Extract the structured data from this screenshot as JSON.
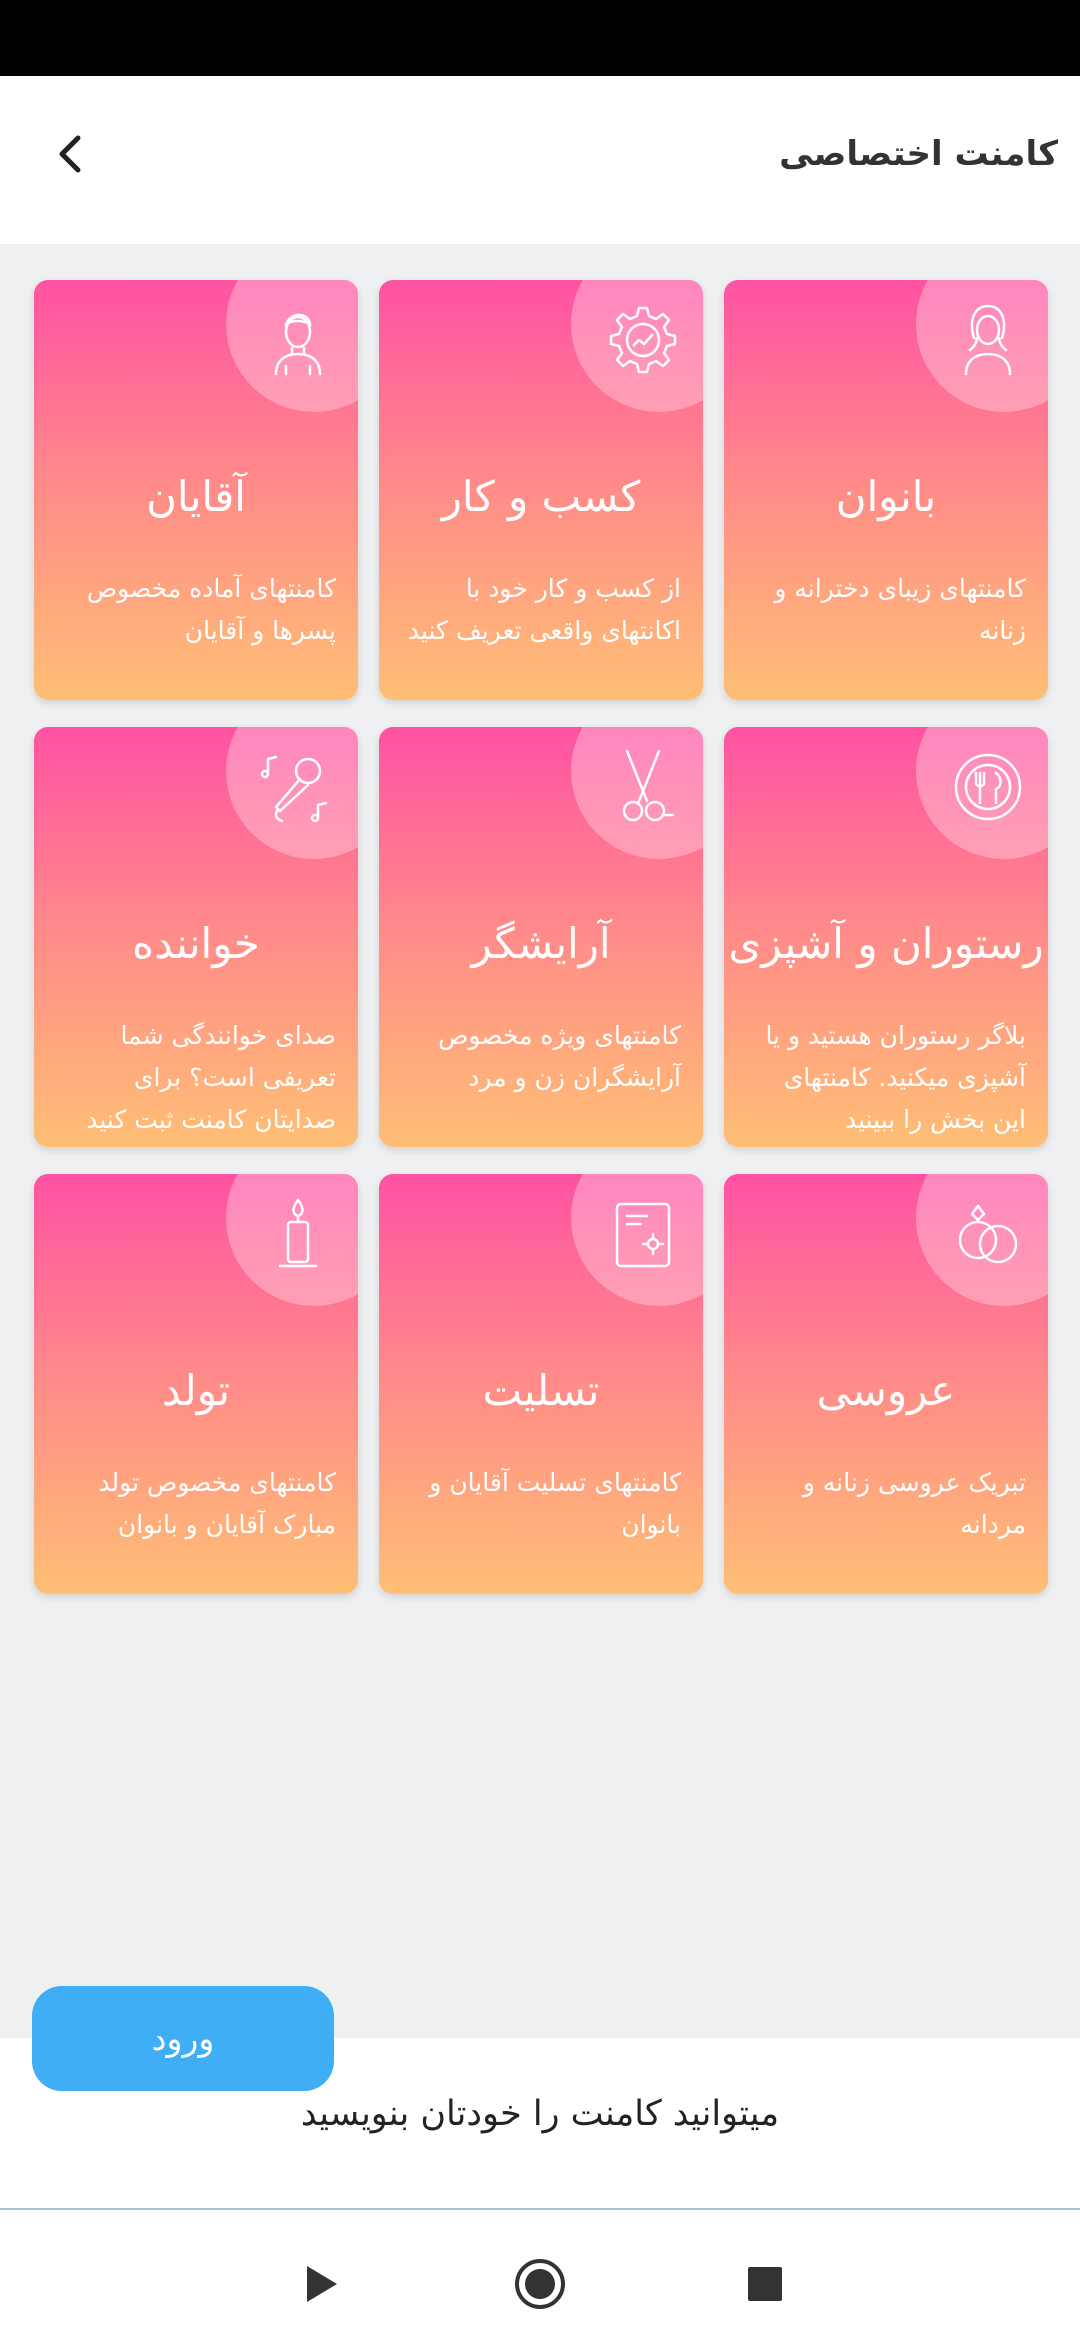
{
  "header": {
    "title": "کامنت اختصاصی"
  },
  "categories": [
    {
      "title": "بانوان",
      "description": "کامنتهای زیبای دخترانه و زنانه",
      "icon": "woman-icon"
    },
    {
      "title": "کسب و  کار",
      "description": "از کسب و کار خود با اکانتهای واقعی تعریف کنید",
      "icon": "gear-chart-icon"
    },
    {
      "title": "آقایان",
      "description": "کامنتهای آماده مخصوص پسرها و آقایان",
      "icon": "man-icon"
    },
    {
      "title": "رستوران و آشپزی",
      "description": "بلاگر رستوران هستید و یا آشپزی میکنید. کامنتهای این بخش را ببینید",
      "icon": "plate-cutlery-icon"
    },
    {
      "title": "آرایشگر",
      "description": "کامنتهای ویژه مخصوص آرایشگران زن و مرد",
      "icon": "scissors-icon"
    },
    {
      "title": "خواننده",
      "description": "صدای خوانندگی شما تعریفی است؟ برای صدایتان کامنت ثبت کنید",
      "icon": "microphone-icon"
    },
    {
      "title": "عروسی",
      "description": "تبریک عروسی زنانه و مردانه",
      "icon": "rings-icon"
    },
    {
      "title": "تسلیت",
      "description": "کامنتهای تسلیت آقایان و بانوان",
      "icon": "condolence-card-icon"
    },
    {
      "title": "تولد",
      "description": "کامنتهای مخصوص تولد مبارک آقایان و بانوان",
      "icon": "candle-icon"
    }
  ],
  "bottom": {
    "hint": "میتوانید کامنت را خودتان بنویسید",
    "login_label": "ورود"
  },
  "colors": {
    "card_gradient_top": "#ff52a3",
    "card_gradient_bottom": "#ffbf75",
    "login_button": "#3faef5"
  }
}
